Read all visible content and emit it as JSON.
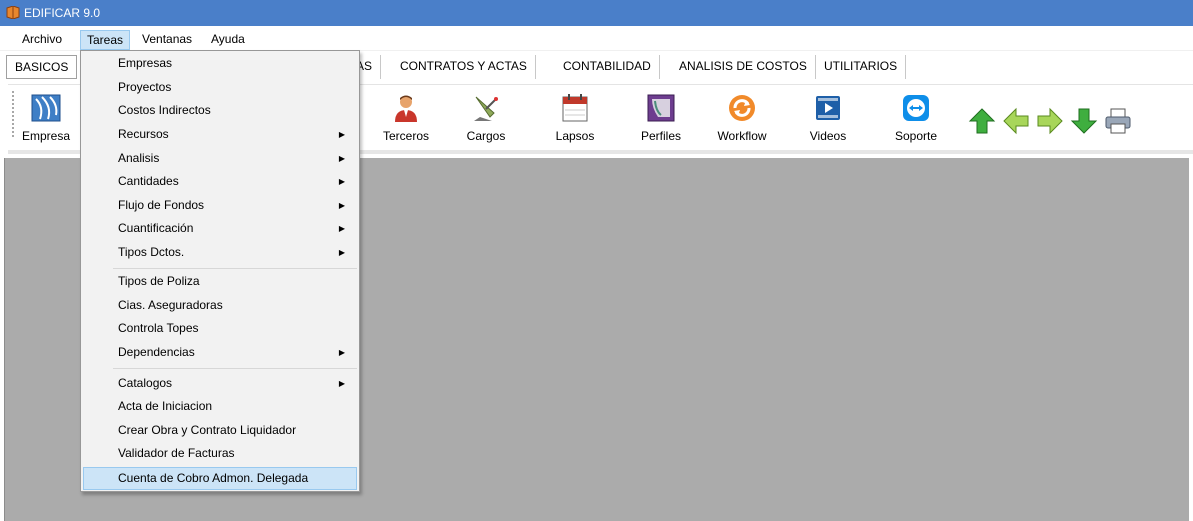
{
  "window": {
    "title": "EDIFICAR 9.0",
    "icon": "edificar-app-icon"
  },
  "menubar": {
    "items": [
      {
        "label": "Archivo"
      },
      {
        "label": "Tareas"
      },
      {
        "label": "Ventanas"
      },
      {
        "label": "Ayuda"
      }
    ]
  },
  "tabs": {
    "items": [
      {
        "label": "BASICOS"
      },
      {
        "label": "AS"
      },
      {
        "label": "CONTRATOS Y ACTAS"
      },
      {
        "label": "CONTABILIDAD"
      },
      {
        "label": "ANALISIS DE COSTOS"
      },
      {
        "label": "UTILITARIOS"
      }
    ]
  },
  "toolbar": {
    "tools": [
      {
        "label": "Empresa",
        "icon": "empresas-icon"
      },
      {
        "label": "Terceros",
        "icon": "person-icon"
      },
      {
        "label": "Cargos",
        "icon": "satellite-icon"
      },
      {
        "label": "Lapsos",
        "icon": "calendar-icon"
      },
      {
        "label": "Perfiles",
        "icon": "profiles-icon"
      },
      {
        "label": "Workflow",
        "icon": "refresh-icon"
      },
      {
        "label": "Videos",
        "icon": "video-icon"
      },
      {
        "label": "Soporte",
        "icon": "remote-support-icon"
      }
    ],
    "nav": [
      "arrow-up-icon",
      "arrow-left-icon",
      "arrow-right-icon",
      "arrow-down-icon",
      "printer-icon"
    ]
  },
  "tareas_menu": {
    "items": [
      {
        "label": "Empresas"
      },
      {
        "label": "Proyectos"
      },
      {
        "label": "Costos Indirectos"
      },
      {
        "label": "Recursos"
      },
      {
        "label": "Analisis"
      },
      {
        "label": "Cantidades"
      },
      {
        "label": "Flujo de Fondos"
      },
      {
        "label": "Cuantificación"
      },
      {
        "label": "Tipos Dctos."
      },
      {
        "label": "Tipos de Poliza"
      },
      {
        "label": "Cias. Aseguradoras"
      },
      {
        "label": "Controla Topes"
      },
      {
        "label": "Dependencias"
      },
      {
        "label": "Catalogos"
      },
      {
        "label": "Acta de Iniciacion"
      },
      {
        "label": "Crear Obra y Contrato Liquidador"
      },
      {
        "label": "Validador de Facturas"
      },
      {
        "label": "Cuenta de Cobro Admon. Delegada"
      }
    ],
    "submenu_arrow": "▶"
  },
  "colors": {
    "titlebar": "#4a7fc9",
    "workspace": "#ababab",
    "highlight": "#cce4f7"
  }
}
